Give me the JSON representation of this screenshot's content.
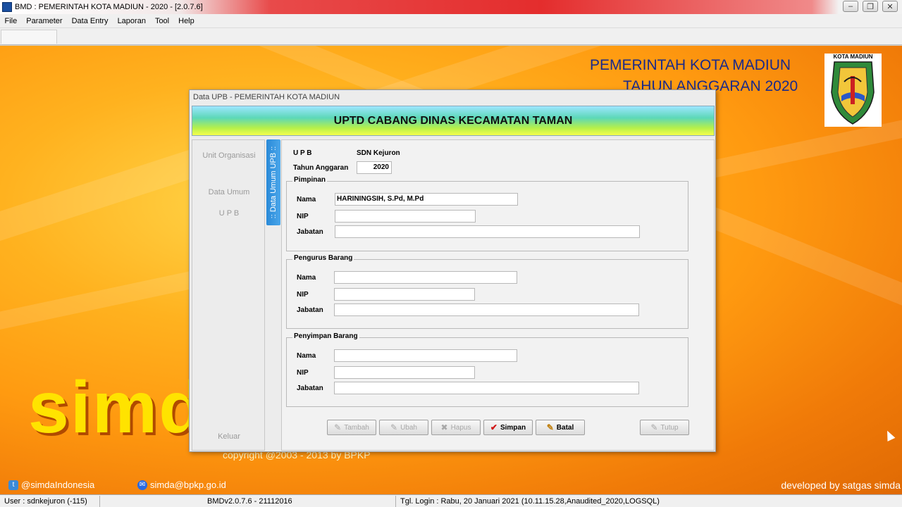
{
  "window": {
    "title": "BMD : PEMERINTAH KOTA MADIUN - 2020 - [2.0.7.6]"
  },
  "menu": [
    "File",
    "Parameter",
    "Data Entry",
    "Laporan",
    "Tool",
    "Help"
  ],
  "background": {
    "header_line1": "PEMERINTAH KOTA MADIUN",
    "header_line2": "TAHUN ANGGARAN 2020",
    "logo_caption": "KOTA MADIUN",
    "simda_word": "simda",
    "copyright": "copyright @2003 - 2013 by BPKP",
    "twitter": "@simdaIndonesia",
    "email": "simda@bpkp.go.id",
    "developed": "developed by satgas simda"
  },
  "dialog": {
    "title": "Data UPB - PEMERINTAH KOTA MADIUN",
    "banner": "UPTD CABANG DINAS KECAMATAN TAMAN",
    "nav": {
      "unit_organisasi": "Unit Organisasi",
      "data_umum": "Data Umum",
      "upb": "U P B",
      "keluar": "Keluar"
    },
    "vertical_tab": ":: Data Umum UPB ::",
    "upb_label": "U P B",
    "upb_value": "SDN Kejuron",
    "tahun_label": "Tahun Anggaran",
    "tahun_value": "2020",
    "groups": {
      "pimpinan": {
        "title": "Pimpinan",
        "nama_label": "Nama",
        "nama_value": "HARININGSIH, S.Pd, M.Pd",
        "nip_label": "NIP",
        "nip_value": "",
        "jabatan_label": "Jabatan",
        "jabatan_value": ""
      },
      "pengurus": {
        "title": "Pengurus Barang",
        "nama_label": "Nama",
        "nama_value": "",
        "nip_label": "NIP",
        "nip_value": "",
        "jabatan_label": "Jabatan",
        "jabatan_value": ""
      },
      "penyimpan": {
        "title": "Penyimpan Barang",
        "nama_label": "Nama",
        "nama_value": "",
        "nip_label": "NIP",
        "nip_value": "",
        "jabatan_label": "Jabatan",
        "jabatan_value": ""
      }
    },
    "buttons": {
      "tambah": "Tambah",
      "ubah": "Ubah",
      "hapus": "Hapus",
      "simpan": "Simpan",
      "batal": "Batal",
      "tutup": "Tutup"
    }
  },
  "status": {
    "user": "User : sdnkejuron (-115)",
    "version": "BMDv2.0.7.6 - 21112016",
    "login": "Tgl. Login :  Rabu,  20 Januari 2021 (10.11.15.28,Anaudited_2020,LOGSQL)"
  }
}
